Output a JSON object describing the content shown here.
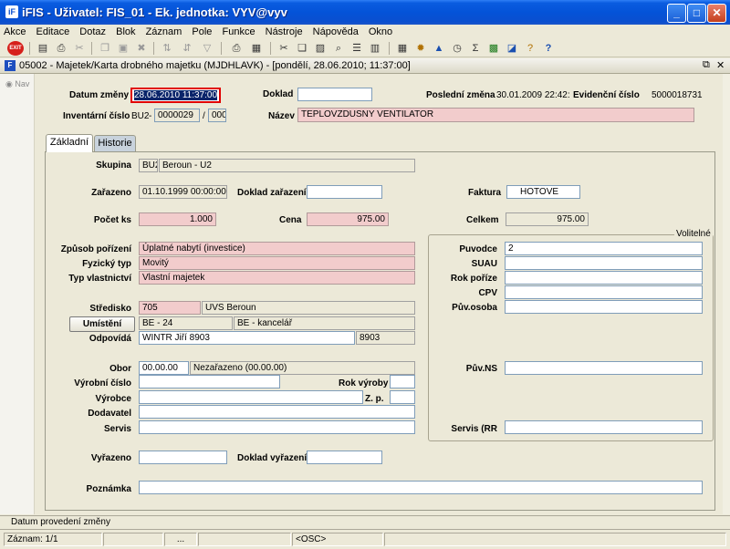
{
  "window": {
    "title": "iFIS - Uživatel: FIS_01 - Ek. jednotka: VYV@vyv",
    "app_icon": "iF",
    "minimize": "_",
    "maximize": "□",
    "close": "✕"
  },
  "menu": [
    "Akce",
    "Editace",
    "Dotaz",
    "Blok",
    "Záznam",
    "Pole",
    "Funkce",
    "Nástroje",
    "Nápověda",
    "Okno"
  ],
  "toolbar": {
    "exit_label": "EXIT",
    "icons": [
      "save-icon",
      "print-icon",
      "cut-icon",
      "copy-icon",
      "paste-icon",
      "query-icon",
      "filter-icon",
      "sort-icon",
      "calculator-icon",
      "help-icon"
    ]
  },
  "subwindow": {
    "icon_text": "F",
    "title": "05002 - Majetek/Karta drobného majetku (MJDHLAVK) - [pondělí, 28.06.2010; 11:37:00]",
    "restore": "⧉",
    "close": "✕"
  },
  "nav": {
    "label": "Nav"
  },
  "header": {
    "datum_zmeny_label": "Datum změny",
    "datum_zmeny_value": "28.06.2010 11:37:00",
    "doklad_label": "Doklad",
    "doklad_value": "",
    "posledni_zmena_label": "Poslední změna",
    "posledni_zmena_value": "30.01.2009 22:42:",
    "evidencni_cislo_label": "Evidenční číslo",
    "evidencni_cislo_value": "5000018731",
    "inventarni_cislo_label": "Inventární číslo",
    "inv_part1": "BU2",
    "inv_dash": "-",
    "inv_part2": "0000029",
    "inv_slash": "/",
    "inv_part3": "000",
    "nazev_label": "Název",
    "nazev_value": "TEPLOVZDUSNY VENTILATOR"
  },
  "tabs": [
    "Základní",
    "Historie"
  ],
  "form": {
    "skupina_label": "Skupina",
    "skupina_code": "BU2",
    "skupina_name": "Beroun - U2",
    "zarazeno_label": "Zařazeno",
    "zarazeno_value": "01.10.1999 00:00:00",
    "doklad_zarazeni_label": "Doklad zařazení",
    "doklad_zarazeni_value": "",
    "faktura_label": "Faktura",
    "faktura_value": "HOTOVE",
    "pocet_ks_label": "Počet ks",
    "pocet_ks_value": "1.000",
    "cena_label": "Cena",
    "cena_value": "975.00",
    "celkem_label": "Celkem",
    "celkem_value": "975.00",
    "zpusob_porizeni_label": "Způsob pořízení",
    "zpusob_porizeni_value": "Úplatné nabytí (investice)",
    "fyzicky_typ_label": "Fyzický typ",
    "fyzicky_typ_value": "Movitý",
    "typ_vlastnictvi_label": "Typ vlastnictví",
    "typ_vlastnictvi_value": "Vlastní majetek",
    "stredisko_label": "Středisko",
    "stredisko_code": "705",
    "stredisko_name": "UVS Beroun",
    "umisteni_label": "Umístění",
    "umisteni_code": "BE - 24",
    "umisteni_name": "BE - kancelář",
    "odpovida_label": "Odpovídá",
    "odpovida_name": "WINTR Jiří 8903",
    "odpovida_code": "8903",
    "obor_label": "Obor",
    "obor_code": "00.00.00",
    "obor_name": "Nezařazeno (00.00.00)",
    "vyrobni_cislo_label": "Výrobní číslo",
    "vyrobni_cislo_value": "",
    "rok_vyroby_label": "Rok výroby",
    "rok_vyroby_value": "",
    "vyrobce_label": "Výrobce",
    "vyrobce_value": "",
    "zp_label": "Z. p.",
    "zp_value": "",
    "dodavatel_label": "Dodavatel",
    "dodavatel_value": "",
    "servis_label": "Servis",
    "servis_value": "",
    "vyrazeno_label": "Vyřazeno",
    "vyrazeno_value": "",
    "doklad_vyrazeni_label": "Doklad vyřazení",
    "doklad_vyrazeni_value": "",
    "poznamka_label": "Poznámka",
    "poznamka_value": ""
  },
  "volitelne": {
    "title": "Volitelné",
    "puvodce_label": "Puvodce",
    "puvodce_value": "2",
    "suau_label": "SUAU",
    "suau_value": "",
    "rok_porize_label": "Rok poříze",
    "rok_porize_value": "",
    "cpv_label": "CPV",
    "cpv_value": "",
    "puv_osoba_label": "Pův.osoba",
    "puv_osoba_value": "",
    "puv_ns_label": "Pův.NS",
    "puv_ns_value": "",
    "servis_rr_label": "Servis (RR",
    "servis_rr_value": ""
  },
  "status": {
    "message": "Datum provedení změny",
    "record": "Záznam: 1/1",
    "ellipsis": "...",
    "osc": "<OSC>"
  }
}
